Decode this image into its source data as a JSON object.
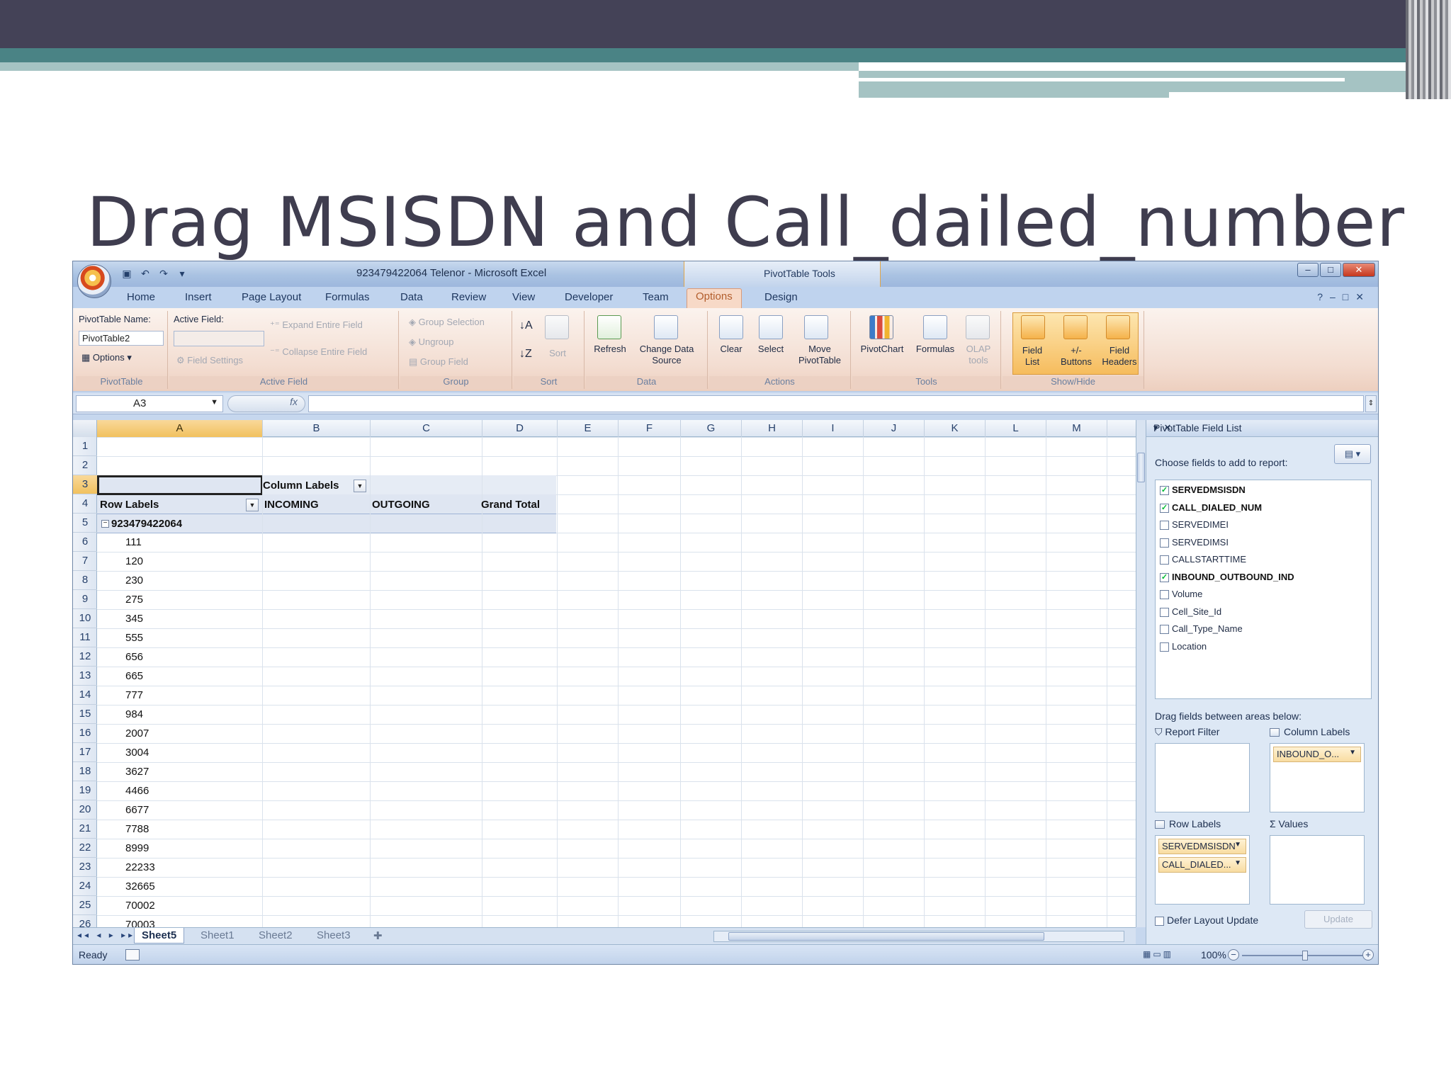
{
  "slide": {
    "title": "Drag MSISDN and Call_dailed_number"
  },
  "window": {
    "title": "923479422064 Telenor - Microsoft Excel",
    "tools_label": "PivotTable Tools"
  },
  "tabs": [
    "Home",
    "Insert",
    "Page Layout",
    "Formulas",
    "Data",
    "Review",
    "View",
    "Developer",
    "Team",
    "Options",
    "Design"
  ],
  "active_tab": "Options",
  "ribbon": {
    "pivottable": {
      "name_label": "PivotTable Name:",
      "name_value": "PivotTable2",
      "options_label": "Options",
      "group_label": "PivotTable"
    },
    "active_field": {
      "label": "Active Field:",
      "field_settings": "Field Settings",
      "expand": "Expand Entire Field",
      "collapse": "Collapse Entire Field",
      "group_label": "Active Field"
    },
    "group": {
      "group_selection": "Group Selection",
      "ungroup": "Ungroup",
      "group_field": "Group Field",
      "group_label": "Group"
    },
    "sort": {
      "sort_label": "Sort",
      "group_label": "Sort"
    },
    "data": {
      "refresh": "Refresh",
      "change_data_source_1": "Change Data",
      "change_data_source_2": "Source",
      "group_label": "Data"
    },
    "actions": {
      "clear": "Clear",
      "select": "Select",
      "move_1": "Move",
      "move_2": "PivotTable",
      "group_label": "Actions"
    },
    "tools": {
      "pivotchart": "PivotChart",
      "formulas": "Formulas",
      "olap_1": "OLAP",
      "olap_2": "tools",
      "group_label": "Tools"
    },
    "showhide": {
      "field_list_1": "Field",
      "field_list_2": "List",
      "buttons_1": "+/-",
      "buttons_2": "Buttons",
      "headers_1": "Field",
      "headers_2": "Headers",
      "group_label": "Show/Hide"
    }
  },
  "formula_bar": {
    "name_box": "A3",
    "fx": "fx",
    "value": ""
  },
  "grid": {
    "columns": [
      "A",
      "B",
      "C",
      "D",
      "E",
      "F",
      "G",
      "H",
      "I",
      "J",
      "K",
      "L",
      "M"
    ],
    "row_numbers": [
      "1",
      "2",
      "3",
      "4",
      "5",
      "6",
      "7",
      "8",
      "9",
      "10",
      "11",
      "12",
      "13",
      "14",
      "15",
      "16",
      "17",
      "18",
      "19",
      "20",
      "21",
      "22",
      "23",
      "24",
      "25",
      "26"
    ],
    "column_labels_header": "Column Labels",
    "row_labels_header": "Row Labels",
    "col_incoming": "INCOMING",
    "col_outgoing": "OUTGOING",
    "col_grand_total": "Grand Total",
    "parent_item": "923479422064",
    "child_items": [
      "111",
      "120",
      "230",
      "275",
      "345",
      "555",
      "656",
      "665",
      "777",
      "984",
      "2007",
      "3004",
      "3627",
      "4466",
      "6677",
      "7788",
      "8999",
      "22233",
      "32665",
      "70002",
      "70003"
    ]
  },
  "sheets": {
    "tabs": [
      "Sheet5",
      "Sheet1",
      "Sheet2",
      "Sheet3"
    ],
    "active": "Sheet5"
  },
  "status": {
    "ready": "Ready",
    "zoom": "100%"
  },
  "field_list": {
    "title": "PivotTable Field List",
    "choose_label": "Choose fields to add to report:",
    "fields": [
      {
        "name": "SERVEDMSISDN",
        "checked": true
      },
      {
        "name": "CALL_DIALED_NUM",
        "checked": true
      },
      {
        "name": "SERVEDIMEI",
        "checked": false
      },
      {
        "name": "SERVEDIMSI",
        "checked": false
      },
      {
        "name": "CALLSTARTTIME",
        "checked": false
      },
      {
        "name": "INBOUND_OUTBOUND_IND",
        "checked": true
      },
      {
        "name": "Volume",
        "checked": false
      },
      {
        "name": "Cell_Site_Id",
        "checked": false
      },
      {
        "name": "Call_Type_Name",
        "checked": false
      },
      {
        "name": "Location",
        "checked": false
      }
    ],
    "drag_label": "Drag fields between areas below:",
    "report_filter": "Report Filter",
    "column_labels": "Column Labels",
    "row_labels": "Row Labels",
    "values": "Values",
    "column_items": [
      "INBOUND_O..."
    ],
    "row_items": [
      "SERVEDMSISDN",
      "CALL_DIALED..."
    ],
    "defer_label": "Defer Layout Update",
    "update_button": "Update"
  }
}
